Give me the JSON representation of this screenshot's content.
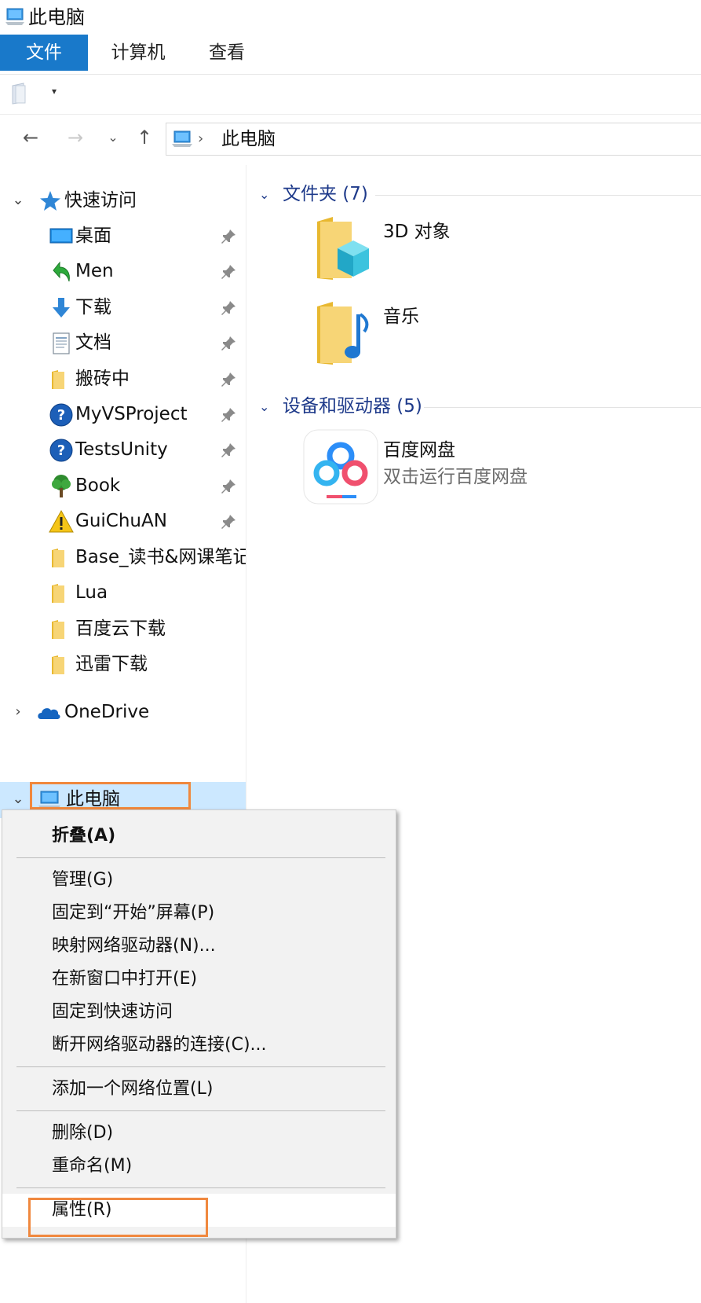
{
  "window": {
    "title": "此电脑"
  },
  "ribbon": {
    "tabs": [
      "文件",
      "计算机",
      "查看"
    ]
  },
  "address": {
    "path": "此电脑",
    "separator": "›"
  },
  "navpane": {
    "quick_access": {
      "label": "快速访问",
      "items": [
        {
          "label": "桌面",
          "icon": "desktop-icon",
          "pinned": true
        },
        {
          "label": "Men",
          "icon": "green-arrow-icon",
          "pinned": true
        },
        {
          "label": "下载",
          "icon": "download-icon",
          "pinned": true
        },
        {
          "label": "文档",
          "icon": "document-icon",
          "pinned": true
        },
        {
          "label": "搬砖中",
          "icon": "folder-icon",
          "pinned": true
        },
        {
          "label": "MyVSProject",
          "icon": "help-icon",
          "pinned": true
        },
        {
          "label": "TestsUnity",
          "icon": "help-icon",
          "pinned": true
        },
        {
          "label": "Book",
          "icon": "tree-icon",
          "pinned": true
        },
        {
          "label": "GuiChuAN",
          "icon": "warning-icon",
          "pinned": true
        },
        {
          "label": "Base_读书&网课笔记",
          "icon": "folder-icon",
          "pinned": false
        },
        {
          "label": "Lua",
          "icon": "folder-icon",
          "pinned": false
        },
        {
          "label": "百度云下载",
          "icon": "folder-icon",
          "pinned": false
        },
        {
          "label": "迅雷下载",
          "icon": "folder-icon",
          "pinned": false
        }
      ]
    },
    "onedrive": {
      "label": "OneDrive"
    },
    "this_pc": {
      "label": "此电脑"
    }
  },
  "content": {
    "folders_group": {
      "title": "文件夹 (7)"
    },
    "folders": [
      {
        "name": "3D 对象",
        "icon": "3d-objects-folder-icon"
      },
      {
        "name": "音乐",
        "icon": "music-folder-icon"
      }
    ],
    "devices_group": {
      "title": "设备和驱动器 (5)"
    },
    "devices": [
      {
        "name": "百度网盘",
        "subtitle": "双击运行百度网盘",
        "icon": "baidu-netdisk-icon"
      }
    ]
  },
  "context_menu": {
    "items": [
      "折叠(A)",
      "管理(G)",
      "固定到“开始”屏幕(P)",
      "映射网络驱动器(N)...",
      "在新窗口中打开(E)",
      "固定到快速访问",
      "断开网络驱动器的连接(C)...",
      "添加一个网络位置(L)",
      "删除(D)",
      "重命名(M)",
      "属性(R)"
    ]
  },
  "colors": {
    "ribbon_file_tab": "#1979ca",
    "selection": "#cce8ff",
    "group_header": "#1e3a8a",
    "annotation_highlight": "#f0883e"
  }
}
